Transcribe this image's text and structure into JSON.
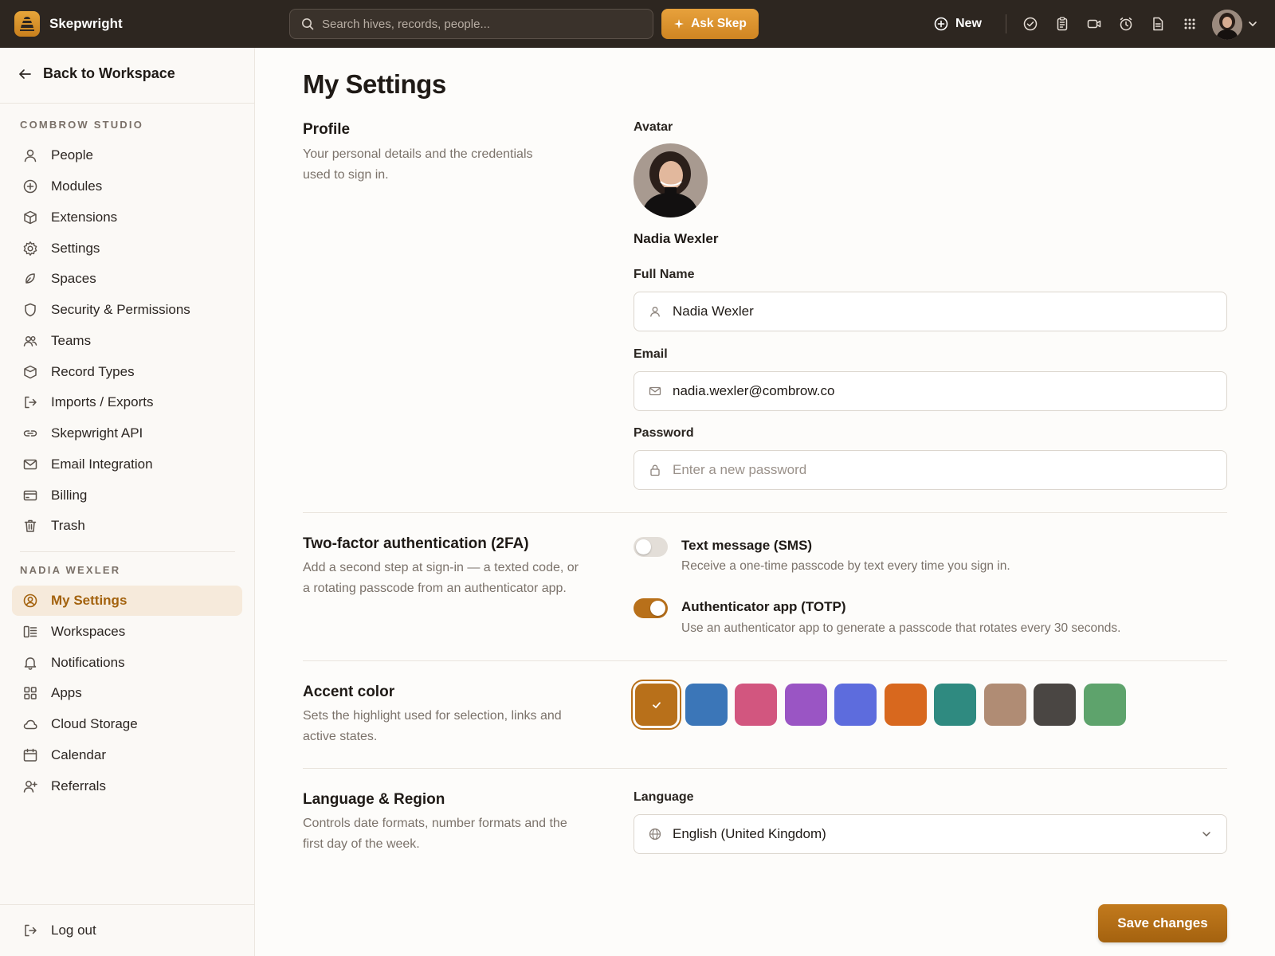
{
  "app": {
    "name": "Skepwright",
    "search_placeholder": "Search hives, records, people...",
    "ask_label": "Ask Skep",
    "new_label": "New"
  },
  "sidebar": {
    "back_label": "Back to Workspace",
    "org_section": "COMBROW STUDIO",
    "org_items": [
      {
        "label": "People",
        "icon": "person-icon"
      },
      {
        "label": "Modules",
        "icon": "plus-circle-icon"
      },
      {
        "label": "Extensions",
        "icon": "cube-icon"
      },
      {
        "label": "Settings",
        "icon": "gear-icon"
      },
      {
        "label": "Spaces",
        "icon": "leaf-icon"
      },
      {
        "label": "Security & Permissions",
        "icon": "shield-icon"
      },
      {
        "label": "Teams",
        "icon": "people-icon"
      },
      {
        "label": "Record Types",
        "icon": "box-icon"
      },
      {
        "label": "Imports / Exports",
        "icon": "export-icon"
      },
      {
        "label": "Skepwright API",
        "icon": "link-icon"
      },
      {
        "label": "Email Integration",
        "icon": "mail-icon"
      },
      {
        "label": "Billing",
        "icon": "card-icon"
      },
      {
        "label": "Trash",
        "icon": "trash-icon"
      }
    ],
    "user_section": "NADIA WEXLER",
    "user_items": [
      {
        "label": "My Settings",
        "icon": "user-circle-icon",
        "active": true
      },
      {
        "label": "Workspaces",
        "icon": "layout-icon"
      },
      {
        "label": "Notifications",
        "icon": "bell-icon"
      },
      {
        "label": "Apps",
        "icon": "grid-icon"
      },
      {
        "label": "Cloud Storage",
        "icon": "cloud-icon"
      },
      {
        "label": "Calendar",
        "icon": "calendar-icon"
      },
      {
        "label": "Referrals",
        "icon": "user-plus-icon"
      }
    ],
    "logout_label": "Log out"
  },
  "page": {
    "title": "My Settings",
    "profile": {
      "title": "Profile",
      "description": "Your personal details and the credentials used to sign in.",
      "avatar_label": "Avatar",
      "display_name": "Nadia Wexler",
      "full_name_label": "Full Name",
      "full_name_value": "Nadia Wexler",
      "email_label": "Email",
      "email_value": "nadia.wexler@combrow.co",
      "password_label": "Password",
      "password_placeholder": "Enter a new password"
    },
    "twofa": {
      "title": "Two-factor authentication (2FA)",
      "description": "Add a second step at sign-in — a texted code, or a rotating passcode from an authenticator app.",
      "options": [
        {
          "title": "Text message (SMS)",
          "description": "Receive a one-time passcode by text every time you sign in.",
          "enabled": false
        },
        {
          "title": "Authenticator app (TOTP)",
          "description": "Use an authenticator app to generate a passcode that rotates every 30 seconds.",
          "enabled": true
        }
      ]
    },
    "accent": {
      "title": "Accent color",
      "description": "Sets the highlight used for selection, links and active states.",
      "selected_index": 0,
      "swatches": [
        "#b8701a",
        "#3b76b8",
        "#d2567f",
        "#9a55c4",
        "#5d6cdd",
        "#d8681e",
        "#2f8a80",
        "#b08c74",
        "#4a4643",
        "#5ea36c"
      ]
    },
    "language": {
      "title": "Language & Region",
      "description": "Controls date formats, number formats and the first day of the week.",
      "label": "Language",
      "value": "English (United Kingdom)"
    },
    "save_label": "Save changes"
  }
}
